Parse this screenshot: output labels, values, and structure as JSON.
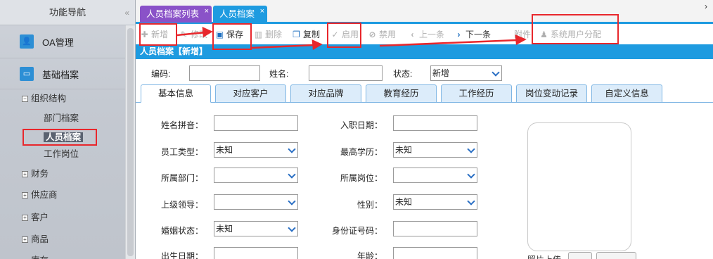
{
  "sidebar": {
    "title": "功能导航",
    "collapse_glyph": "«",
    "sections": [
      {
        "label": "OA管理",
        "icon": "person-icon"
      },
      {
        "label": "基础档案",
        "icon": "card-icon"
      }
    ],
    "tree": {
      "org": {
        "label": "组织结构",
        "toggle": "⊟"
      },
      "children": [
        "部门档案",
        "人员档案",
        "工作岗位"
      ],
      "groups": [
        {
          "label": "财务",
          "toggle": "⊞"
        },
        {
          "label": "供应商",
          "toggle": "⊞"
        },
        {
          "label": "客户",
          "toggle": "⊞"
        },
        {
          "label": "商品",
          "toggle": "⊞"
        },
        {
          "label": "库存",
          "toggle": "⊞"
        }
      ]
    }
  },
  "tabs": [
    {
      "label": "人员档案列表",
      "close": "×"
    },
    {
      "label": "人员档案",
      "close": "×"
    }
  ],
  "tabs_arrow": "›",
  "toolbar": {
    "new": "新增",
    "edit": "修改",
    "save": "保存",
    "delete": "删除",
    "copy": "复制",
    "enable": "启用",
    "disable": "禁用",
    "prev": "上一条",
    "next": "下一条",
    "attach": "附件",
    "assign": "系统用户分配"
  },
  "panel": {
    "title": "人员档案【新增】"
  },
  "filter": {
    "code_label": "编码:",
    "code_value": "",
    "name_label": "姓名:",
    "name_value": "",
    "status_label": "状态:",
    "status_value": "新增"
  },
  "subtabs": [
    "基本信息",
    "对应客户",
    "对应品牌",
    "教育经历",
    "工作经历",
    "岗位变动记录",
    "自定义信息"
  ],
  "form": {
    "left": [
      {
        "label": "姓名拼音：",
        "type": "input",
        "value": ""
      },
      {
        "label": "员工类型：",
        "type": "select",
        "value": "未知"
      },
      {
        "label": "所属部门：",
        "type": "select",
        "value": ""
      },
      {
        "label": "上级领导：",
        "type": "select",
        "value": ""
      },
      {
        "label": "婚姻状态：",
        "type": "select",
        "value": "未知"
      },
      {
        "label": "出生日期：",
        "type": "input",
        "value": ""
      }
    ],
    "right": [
      {
        "label": "入职日期：",
        "type": "input",
        "value": ""
      },
      {
        "label": "最高学历：",
        "type": "select",
        "value": "未知"
      },
      {
        "label": "所属岗位：",
        "type": "select",
        "value": ""
      },
      {
        "label": "性别：",
        "type": "select",
        "value": "未知"
      },
      {
        "label": "身份证号码：",
        "type": "input",
        "value": ""
      },
      {
        "label": "年龄：",
        "type": "input",
        "value": ""
      }
    ],
    "photo_label": "照片上传"
  },
  "colors": {
    "accent": "#1e9be0",
    "tab_active": "#8a52c8",
    "annotation": "#e8272c"
  }
}
